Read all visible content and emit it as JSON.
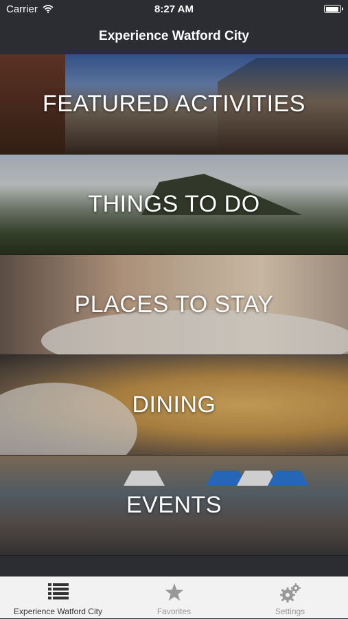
{
  "status_bar": {
    "carrier": "Carrier",
    "time": "8:27 AM"
  },
  "nav": {
    "title": "Experience Watford City"
  },
  "menu": {
    "featured": "FEATURED ACTIVITIES",
    "things_to_do": "THINGS TO DO",
    "places_to_stay": "PLACES TO STAY",
    "dining": "DINING",
    "events": "EVENTS"
  },
  "tabs": [
    {
      "label": "Experience Watford City",
      "icon": "list-icon",
      "selected": true
    },
    {
      "label": "Favorites",
      "icon": "star-icon",
      "selected": false
    },
    {
      "label": "Settings",
      "icon": "gears-icon",
      "selected": false
    }
  ],
  "colors": {
    "nav_bg": "#2b2d33",
    "tab_active": "#333333",
    "tab_inactive": "#999999"
  }
}
